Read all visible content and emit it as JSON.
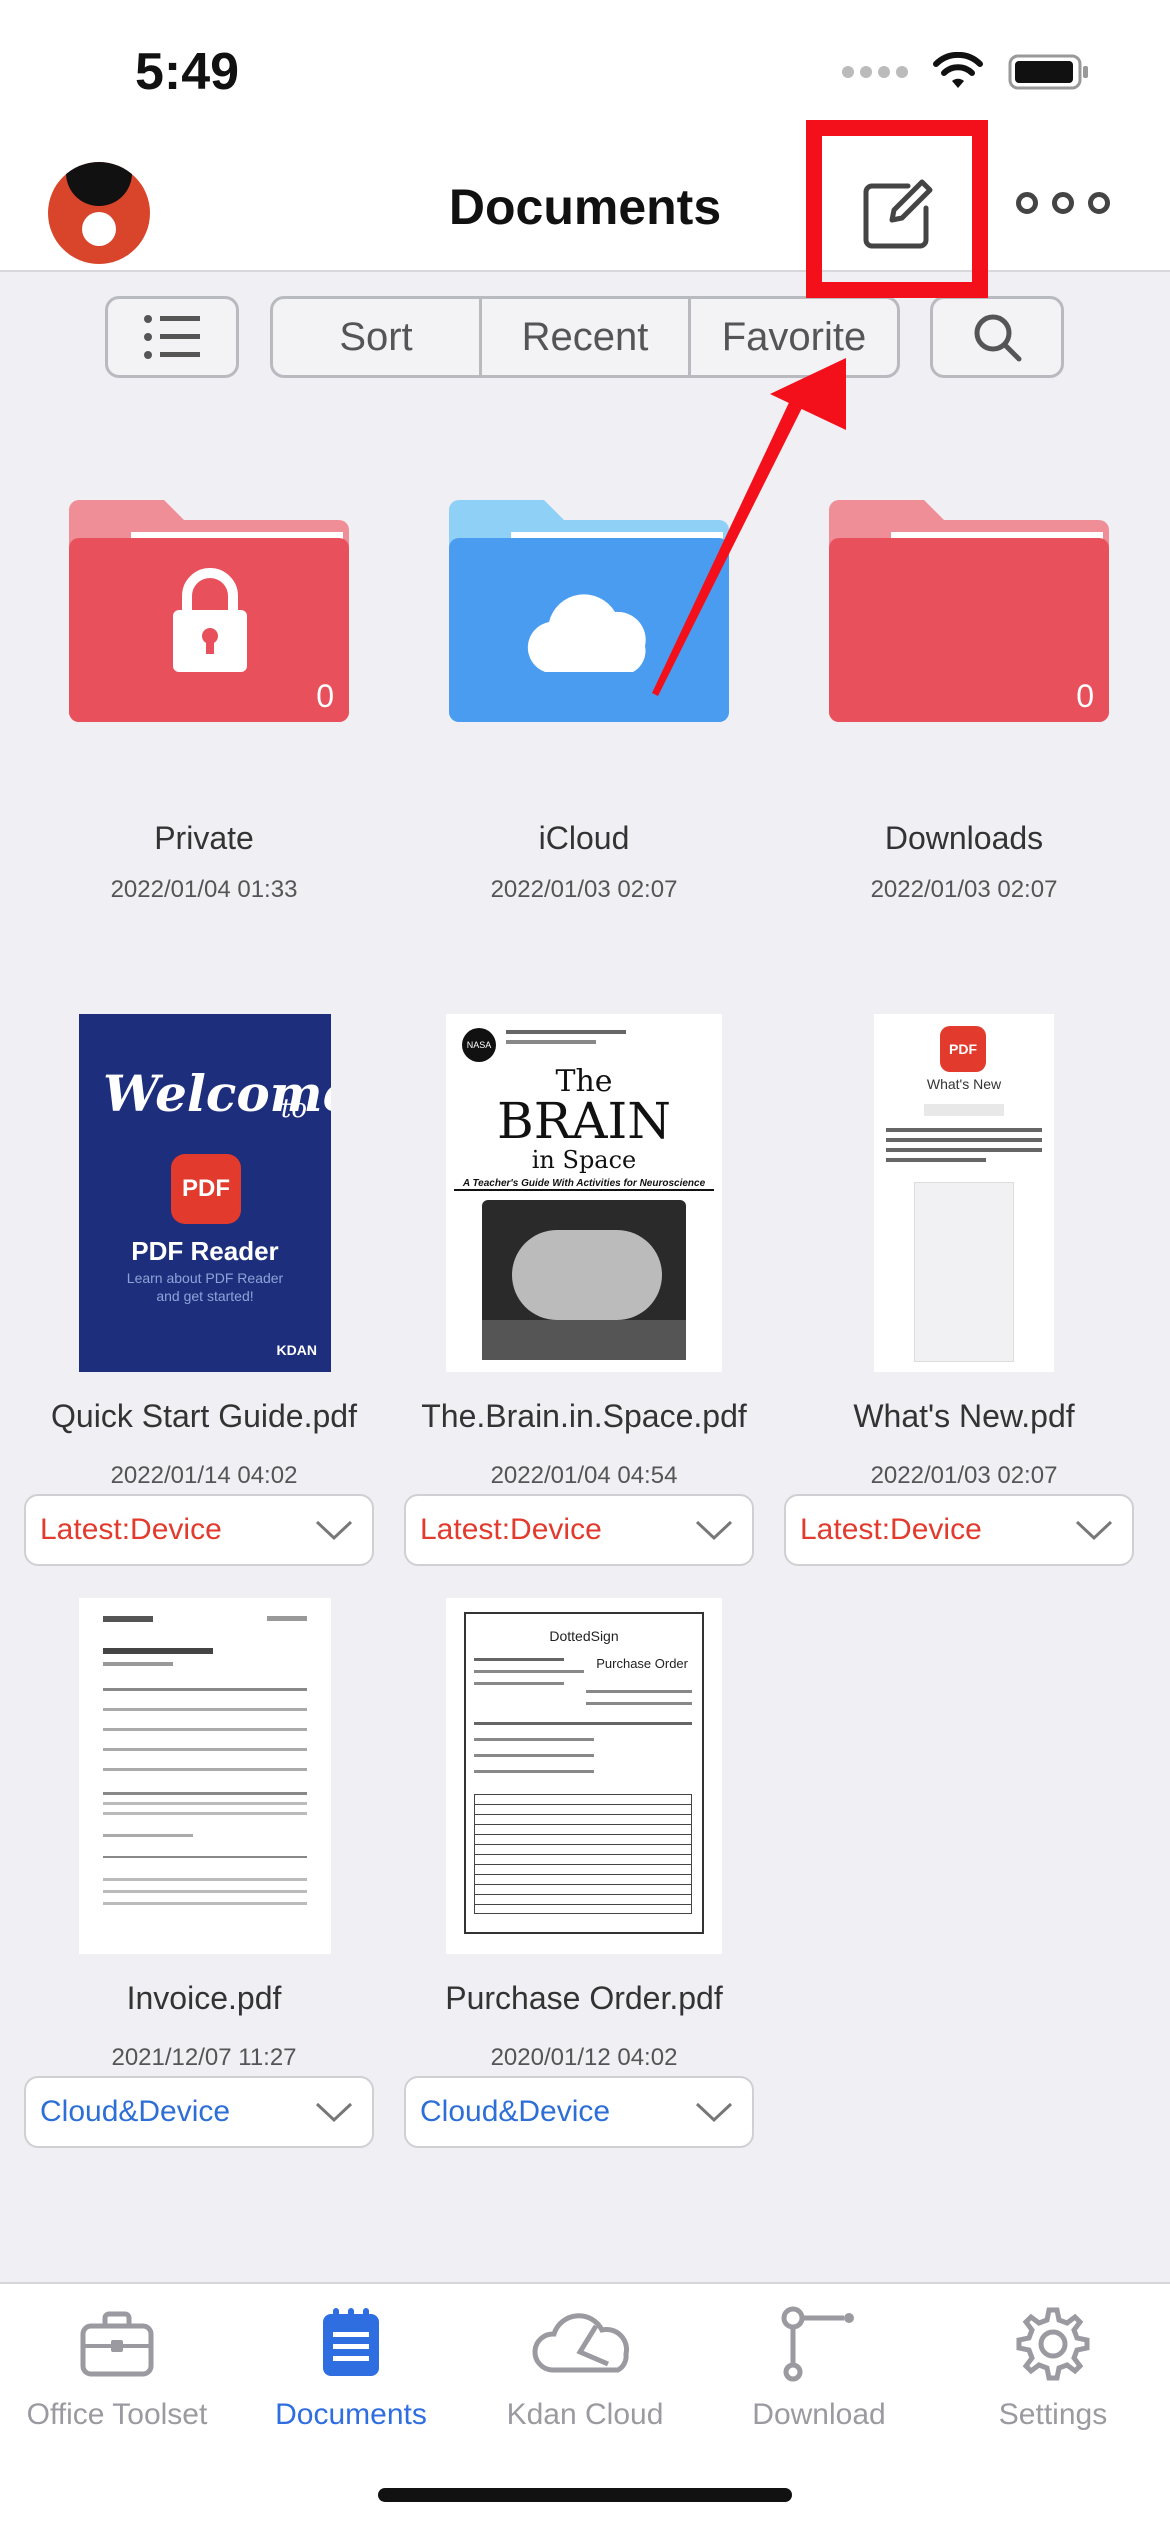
{
  "status": {
    "time": "5:49"
  },
  "header": {
    "title": "Documents"
  },
  "toolbar": {
    "sort": "Sort",
    "recent": "Recent",
    "favorite": "Favorite"
  },
  "folders": [
    {
      "name": "Private",
      "date": "2022/01/04 01:33",
      "count": "0",
      "color": "#e8505b"
    },
    {
      "name": "iCloud",
      "date": "2022/01/03 02:07",
      "color": "#4a9cf0"
    },
    {
      "name": "Downloads",
      "date": "2022/01/03 02:07",
      "count": "0",
      "color": "#e8505b"
    }
  ],
  "files": [
    {
      "name": "Quick Start Guide.pdf",
      "date": "2022/01/14 04:02",
      "sync": "Latest:Device",
      "thumb": {
        "welcome": "Welcome",
        "to": "to",
        "badge": "PDF",
        "title": "PDF Reader",
        "sub1": "Learn about PDF Reader",
        "sub2": "and get started!",
        "brand": "KDAN"
      }
    },
    {
      "name": "The.Brain.in.Space.pdf",
      "date": "2022/01/04 04:54",
      "sync": "Latest:Device",
      "thumb": {
        "the": "The",
        "brain": "BRAIN",
        "inspace": "in Space",
        "subtitle": "A Teacher's Guide With Activities for Neuroscience",
        "logo": "NASA"
      }
    },
    {
      "name": "What's New.pdf",
      "date": "2022/01/03 02:07",
      "sync": "Latest:Device",
      "thumb": {
        "badge": "PDF",
        "title": "What's New"
      }
    },
    {
      "name": "Invoice.pdf",
      "date": "2021/12/07 11:27",
      "sync": "Cloud&Device"
    },
    {
      "name": "Purchase Order.pdf",
      "date": "2020/01/12 04:02",
      "sync": "Cloud&Device",
      "thumb": {
        "brand": "DottedSign",
        "title": "Purchase Order"
      }
    }
  ],
  "tabs": [
    {
      "label": "Office Toolset"
    },
    {
      "label": "Documents"
    },
    {
      "label": "Kdan Cloud"
    },
    {
      "label": "Download"
    },
    {
      "label": "Settings"
    }
  ],
  "colors": {
    "accent": "#2f6ee0",
    "highlight": "#f3101b",
    "sync_red": "#e23a2c",
    "sync_blue": "#2d6fd6"
  }
}
